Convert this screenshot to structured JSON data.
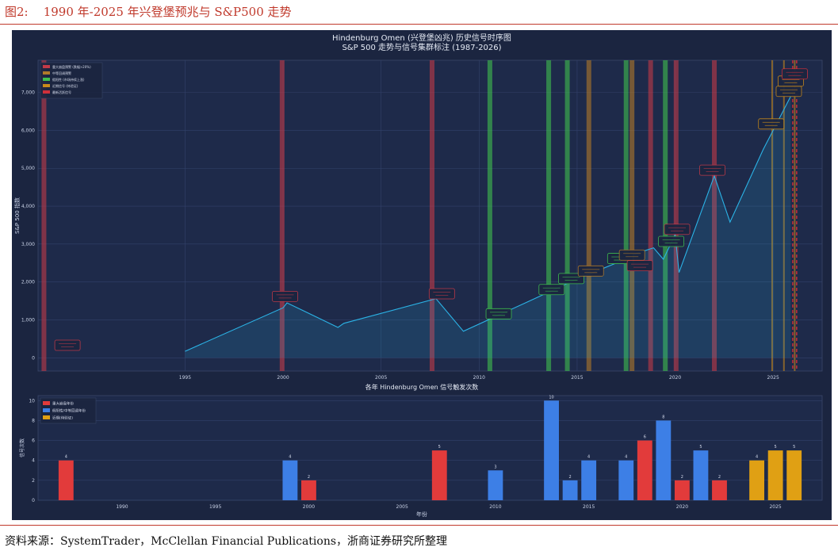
{
  "figure": {
    "label": "图2:",
    "title": "1990 年-2025 年兴登堡预兆与 S&P500 走势",
    "source": "资料来源：SystemTrader，McClellan Financial Publications，浙商证券研究所整理"
  },
  "colors": {
    "rule": "#c0392b",
    "panel_bg": "#1b2540",
    "plot_bg": "#1e2a4a",
    "line": "#2bb3e6",
    "major": "#c23a48",
    "medium": "#b07a2a",
    "neutral": "#3fbf4f",
    "recent": "#c98a1a",
    "latest": "#d0303a",
    "bar_red": "#e23b3b",
    "bar_blue": "#3d7fe6",
    "bar_orange": "#e0a014"
  },
  "chart_data": [
    {
      "type": "line",
      "title": "Hindenburg Omen (兴登堡凶兆) 历史信号时序图",
      "subtitle": "S&P 500 走势与信号集群标注 (1987-2026)",
      "xlabel": "",
      "ylabel": "S&P 500 指数",
      "xlim": [
        1987.5,
        2027.5
      ],
      "ylim": [
        -350,
        7850
      ],
      "xticks": [
        1995,
        2000,
        2005,
        2010,
        2015,
        2020,
        2025
      ],
      "yticks": [
        0,
        1000,
        2000,
        3000,
        4000,
        5000,
        6000,
        7000
      ],
      "ytick_labels": [
        "0",
        "1,000",
        "2,000",
        "3,000",
        "4,000",
        "5,000",
        "6,000",
        "7,000"
      ],
      "grid": true,
      "legend_position": "top-left",
      "legend": [
        {
          "label": "重大崩盘预警 (跌幅>20%)",
          "color": "#c23a48"
        },
        {
          "label": "中等回调预警",
          "color": "#b07a2a"
        },
        {
          "label": "假阳性 (市场持续上涨)",
          "color": "#3fbf4f"
        },
        {
          "label": "近期信号 (待验证)",
          "color": "#c98a1a"
        },
        {
          "label": "最新活跃信号",
          "color": "#d0303a"
        }
      ],
      "series": [
        {
          "x": [
            1995,
            2000,
            2000.2,
            2002.8,
            2003.1,
            2007.8,
            2009.2,
            2013,
            2015,
            2017,
            2018,
            2018.9,
            2019.4,
            2020.0,
            2020.2,
            2022.0,
            2022.8,
            2024.5,
            2025.0,
            2025.9
          ],
          "values": [
            170,
            1320,
            1450,
            800,
            910,
            1560,
            700,
            1600,
            2080,
            2500,
            2750,
            2900,
            2600,
            3250,
            2250,
            4800,
            3580,
            5500,
            6000,
            6900
          ]
        }
      ],
      "signal_bands": [
        {
          "x": 1987.8,
          "kind": "major"
        },
        {
          "x": 1999.95,
          "kind": "major"
        },
        {
          "x": 2007.6,
          "kind": "major"
        },
        {
          "x": 2010.55,
          "kind": "neutral"
        },
        {
          "x": 2013.55,
          "kind": "neutral"
        },
        {
          "x": 2014.5,
          "kind": "neutral"
        },
        {
          "x": 2015.6,
          "kind": "medium"
        },
        {
          "x": 2017.5,
          "kind": "neutral"
        },
        {
          "x": 2017.8,
          "kind": "medium"
        },
        {
          "x": 2018.75,
          "kind": "major"
        },
        {
          "x": 2019.5,
          "kind": "neutral"
        },
        {
          "x": 2020.05,
          "kind": "major"
        },
        {
          "x": 2022.0,
          "kind": "major"
        },
        {
          "x": 2024.95,
          "kind": "recent"
        },
        {
          "x": 2025.55,
          "kind": "recent"
        },
        {
          "x": 2026.0,
          "kind": "latest"
        },
        {
          "x": 2026.1,
          "kind": "recent"
        },
        {
          "x": 2026.2,
          "kind": "latest"
        }
      ],
      "annotations": [
        {
          "x": 1989.0,
          "y": 340,
          "kind": "major"
        },
        {
          "x": 2000.1,
          "y": 1630,
          "kind": "major"
        },
        {
          "x": 2008.1,
          "y": 1700,
          "kind": "major"
        },
        {
          "x": 2011.0,
          "y": 1170,
          "kind": "neutral"
        },
        {
          "x": 2013.7,
          "y": 1810,
          "kind": "neutral"
        },
        {
          "x": 2014.7,
          "y": 2100,
          "kind": "neutral"
        },
        {
          "x": 2015.7,
          "y": 2300,
          "kind": "medium"
        },
        {
          "x": 2017.2,
          "y": 2630,
          "kind": "neutral"
        },
        {
          "x": 2017.8,
          "y": 2720,
          "kind": "medium"
        },
        {
          "x": 2018.2,
          "y": 2440,
          "kind": "major"
        },
        {
          "x": 2019.8,
          "y": 3080,
          "kind": "neutral"
        },
        {
          "x": 2020.1,
          "y": 3400,
          "kind": "major"
        },
        {
          "x": 2021.9,
          "y": 4960,
          "kind": "major"
        },
        {
          "x": 2024.9,
          "y": 6180,
          "kind": "recent"
        },
        {
          "x": 2025.8,
          "y": 7040,
          "kind": "recent"
        },
        {
          "x": 2025.9,
          "y": 7310,
          "kind": "recent"
        },
        {
          "x": 2026.1,
          "y": 7500,
          "kind": "latest"
        }
      ]
    },
    {
      "type": "bar",
      "title": "各年 Hindenburg Omen 信号触发次数",
      "xlabel": "年份",
      "ylabel": "信号次数",
      "xlim": [
        1985.5,
        2027.5
      ],
      "ylim": [
        0,
        10.5
      ],
      "xticks": [
        1990,
        1995,
        2000,
        2005,
        2010,
        2015,
        2020,
        2025
      ],
      "yticks": [
        0,
        2,
        4,
        6,
        8,
        10
      ],
      "grid": true,
      "legend_position": "top-left",
      "legend": [
        {
          "label": "重大崩盘年份",
          "color": "#e23b3b"
        },
        {
          "label": "假阳性/中等回调年份",
          "color": "#3d7fe6"
        },
        {
          "label": "近期(待验证)",
          "color": "#e0a014"
        }
      ],
      "bars": [
        {
          "year": 1987,
          "value": 4,
          "kind": "red"
        },
        {
          "year": 1999,
          "value": 4,
          "kind": "blue"
        },
        {
          "year": 2000,
          "value": 2,
          "kind": "red"
        },
        {
          "year": 2007,
          "value": 5,
          "kind": "red"
        },
        {
          "year": 2010,
          "value": 3,
          "kind": "blue"
        },
        {
          "year": 2013,
          "value": 10,
          "kind": "blue"
        },
        {
          "year": 2014,
          "value": 2,
          "kind": "blue"
        },
        {
          "year": 2015,
          "value": 4,
          "kind": "blue"
        },
        {
          "year": 2017,
          "value": 4,
          "kind": "blue"
        },
        {
          "year": 2018,
          "value": 6,
          "kind": "red"
        },
        {
          "year": 2019,
          "value": 8,
          "kind": "blue"
        },
        {
          "year": 2020,
          "value": 2,
          "kind": "red"
        },
        {
          "year": 2021,
          "value": 5,
          "kind": "blue"
        },
        {
          "year": 2022,
          "value": 2,
          "kind": "red"
        },
        {
          "year": 2024,
          "value": 4,
          "kind": "orange"
        },
        {
          "year": 2025,
          "value": 5,
          "kind": "orange"
        },
        {
          "year": 2026,
          "value": 5,
          "kind": "orange"
        }
      ]
    }
  ]
}
